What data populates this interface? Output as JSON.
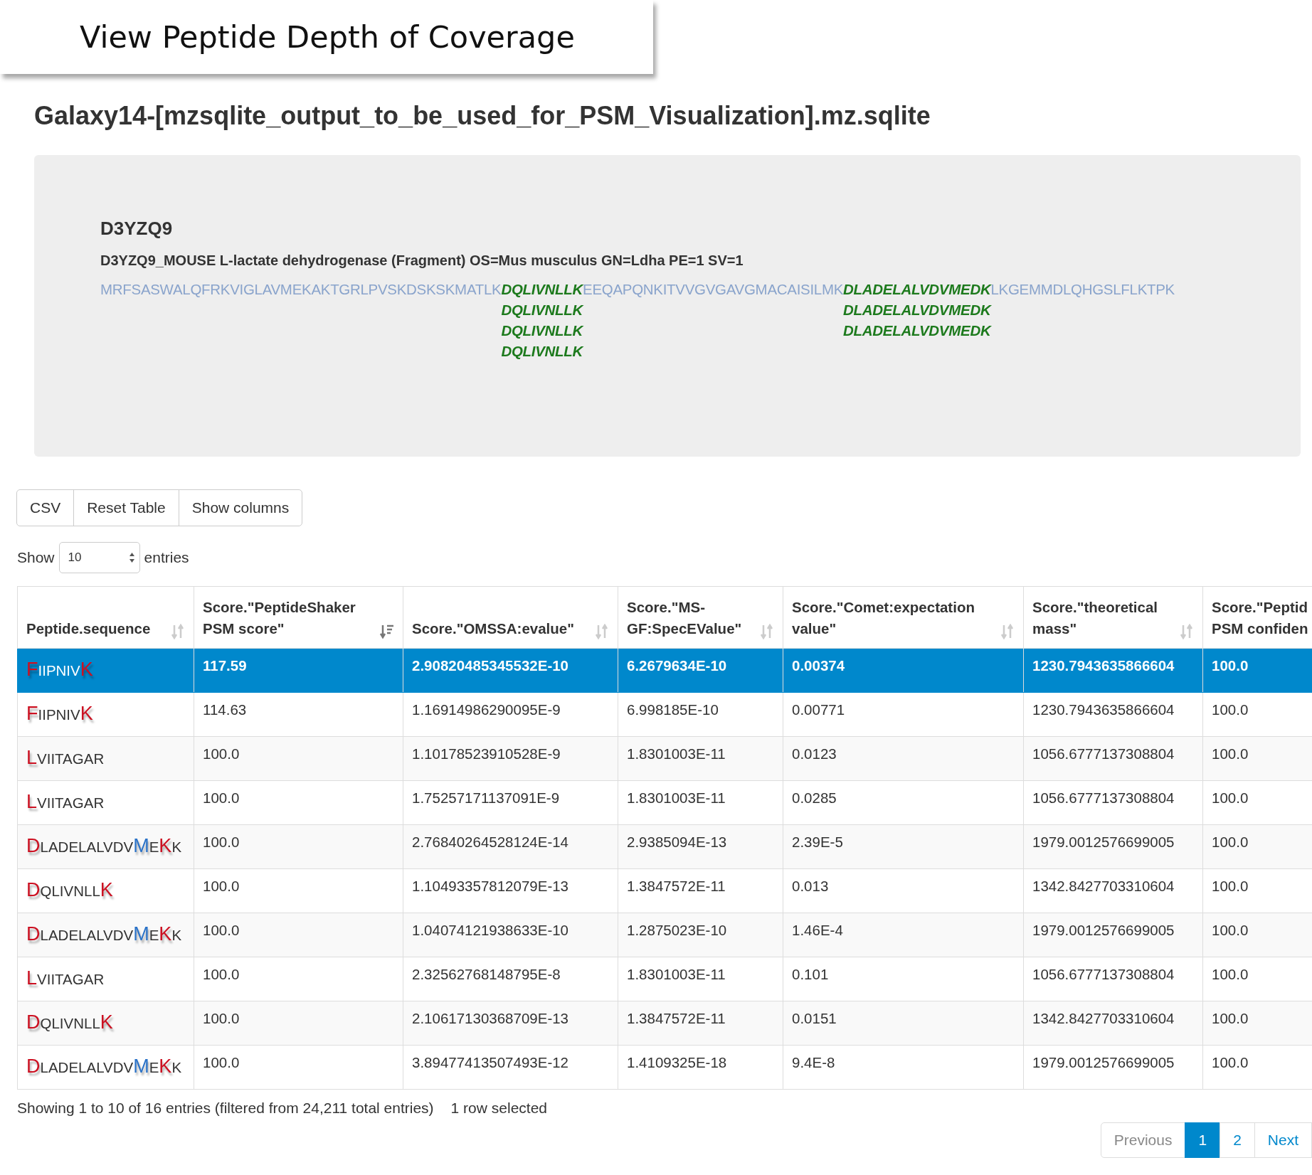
{
  "banner": {
    "title": "View Peptide Depth of Coverage"
  },
  "file_title": "Galaxy14-[mzsqlite_output_to_be_used_for_PSM_Visualization].mz.sqlite",
  "protein": {
    "accession": "D3YZQ9",
    "description": "D3YZQ9_MOUSE L-lactate dehydrogenase (Fragment) OS=Mus musculus GN=Ldha PE=1 SV=1",
    "segments": [
      {
        "text": "MRFSASWALQFRKVIGLAVMEKAKTGRLPVSKDSKSKMATLK",
        "covered": false
      },
      {
        "text": "DQLIVNLLK",
        "covered": true,
        "stack": [
          "DQLIVNLLK",
          "DQLIVNLLK",
          "DQLIVNLLK"
        ]
      },
      {
        "text": "EEQAPQNKITVVGVGAVGMACAISILMK",
        "covered": false
      },
      {
        "text": "DLADELALVDVMEDK",
        "covered": true,
        "stack": [
          "DLADELALVDVMEDK",
          "DLADELALVDVMEDK"
        ]
      },
      {
        "text": "LKGEMMDLQHGSLFLKTPK",
        "covered": false
      }
    ]
  },
  "toolbar": {
    "buttons": [
      "CSV",
      "Reset Table",
      "Show columns"
    ]
  },
  "length_menu": {
    "before": "Show",
    "value": "10",
    "after": "entries"
  },
  "table": {
    "columns": [
      {
        "label": "Peptide.sequence",
        "sorted": false
      },
      {
        "label": "Score.\"PeptideShaker PSM score\"",
        "sorted": true
      },
      {
        "label": "Score.\"OMSSA:evalue\"",
        "sorted": false
      },
      {
        "label": "Score.\"MS-GF:SpecEValue\"",
        "sorted": false
      },
      {
        "label": "Score.\"Comet:expectation value\"",
        "sorted": false
      },
      {
        "label": "Score.\"theoretical mass\"",
        "sorted": false
      },
      {
        "label": "Score.\"Peptid PSM confiden"
      }
    ],
    "rows": [
      {
        "selected": true,
        "cells": [
          {
            "segments": [
              {
                "text": "F",
                "color": "#cc1122"
              },
              {
                "text": "IIPNIV"
              },
              {
                "text": "K",
                "color": "#cc1122"
              }
            ]
          },
          "117.59",
          "2.90820485345532E-10",
          "6.2679634E-10",
          "0.00374",
          "1230.7943635866604",
          "100.0"
        ]
      },
      {
        "selected": false,
        "cells": [
          {
            "segments": [
              {
                "text": "F",
                "color": "#cc1122"
              },
              {
                "text": "IIPNIV"
              },
              {
                "text": "K",
                "color": "#cc1122"
              }
            ]
          },
          "114.63",
          "1.16914986290095E-9",
          "6.998185E-10",
          "0.00771",
          "1230.7943635866604",
          "100.0"
        ]
      },
      {
        "selected": false,
        "cells": [
          {
            "segments": [
              {
                "text": "L",
                "color": "#cc1122"
              },
              {
                "text": "VIITAGAR"
              }
            ]
          },
          "100.0",
          "1.10178523910528E-9",
          "1.8301003E-11",
          "0.0123",
          "1056.6777137308804",
          "100.0"
        ]
      },
      {
        "selected": false,
        "cells": [
          {
            "segments": [
              {
                "text": "L",
                "color": "#cc1122"
              },
              {
                "text": "VIITAGAR"
              }
            ]
          },
          "100.0",
          "1.75257171137091E-9",
          "1.8301003E-11",
          "0.0285",
          "1056.6777137308804",
          "100.0"
        ]
      },
      {
        "selected": false,
        "cells": [
          {
            "segments": [
              {
                "text": "D",
                "color": "#cc1122"
              },
              {
                "text": "LADELALVDV"
              },
              {
                "text": "M",
                "color": "#2a72c8"
              },
              {
                "text": "E"
              },
              {
                "text": "K",
                "color": "#cc1122"
              },
              {
                "text": "K"
              }
            ]
          },
          "100.0",
          "2.76840264528124E-14",
          "2.9385094E-13",
          "2.39E-5",
          "1979.0012576699005",
          "100.0"
        ]
      },
      {
        "selected": false,
        "cells": [
          {
            "segments": [
              {
                "text": "D",
                "color": "#cc1122"
              },
              {
                "text": "QLIVNLL"
              },
              {
                "text": "K",
                "color": "#cc1122"
              }
            ]
          },
          "100.0",
          "1.10493357812079E-13",
          "1.3847572E-11",
          "0.013",
          "1342.8427703310604",
          "100.0"
        ]
      },
      {
        "selected": false,
        "cells": [
          {
            "segments": [
              {
                "text": "D",
                "color": "#cc1122"
              },
              {
                "text": "LADELALVDV"
              },
              {
                "text": "M",
                "color": "#2a72c8"
              },
              {
                "text": "E"
              },
              {
                "text": "K",
                "color": "#cc1122"
              },
              {
                "text": "K"
              }
            ]
          },
          "100.0",
          "1.04074121938633E-10",
          "1.2875023E-10",
          "1.46E-4",
          "1979.0012576699005",
          "100.0"
        ]
      },
      {
        "selected": false,
        "cells": [
          {
            "segments": [
              {
                "text": "L",
                "color": "#cc1122"
              },
              {
                "text": "VIITAGAR"
              }
            ]
          },
          "100.0",
          "2.32562768148795E-8",
          "1.8301003E-11",
          "0.101",
          "1056.6777137308804",
          "100.0"
        ]
      },
      {
        "selected": false,
        "cells": [
          {
            "segments": [
              {
                "text": "D",
                "color": "#cc1122"
              },
              {
                "text": "QLIVNLL"
              },
              {
                "text": "K",
                "color": "#cc1122"
              }
            ]
          },
          "100.0",
          "2.10617130368709E-13",
          "1.3847572E-11",
          "0.0151",
          "1342.8427703310604",
          "100.0"
        ]
      },
      {
        "selected": false,
        "cells": [
          {
            "segments": [
              {
                "text": "D",
                "color": "#cc1122"
              },
              {
                "text": "LADELALVDV"
              },
              {
                "text": "M",
                "color": "#2a72c8"
              },
              {
                "text": "E"
              },
              {
                "text": "K",
                "color": "#cc1122"
              },
              {
                "text": "K"
              }
            ]
          },
          "100.0",
          "3.89477413507493E-12",
          "1.4109325E-18",
          "9.4E-8",
          "1979.0012576699005",
          "100.0"
        ]
      }
    ]
  },
  "info": {
    "summary": "Showing 1 to 10 of 16 entries (filtered from 24,211 total entries)",
    "selection": "1 row selected"
  },
  "pagination": [
    {
      "label": "Previous",
      "kind": "nav",
      "selected": false
    },
    {
      "label": "1",
      "kind": "page",
      "selected": true
    },
    {
      "label": "2",
      "kind": "page",
      "selected": false
    },
    {
      "label": "Next",
      "kind": "nav",
      "selected": false
    }
  ]
}
